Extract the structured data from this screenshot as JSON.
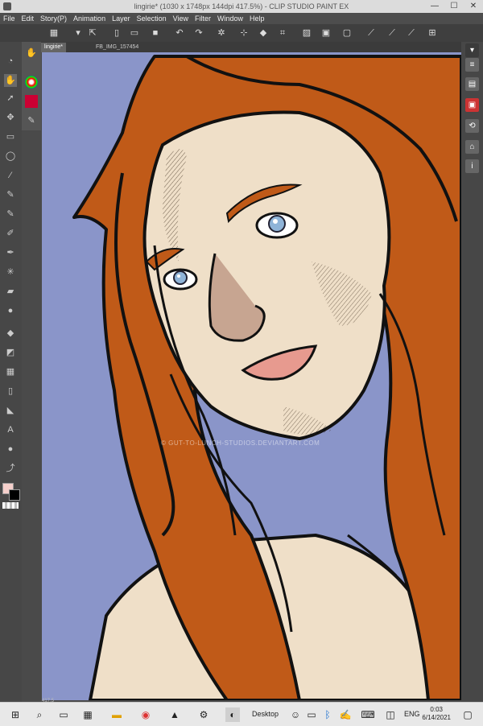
{
  "window": {
    "title": "lingirie* (1030 x 1748px 144dpi 417.5%) - CLIP STUDIO PAINT EX",
    "controls": [
      "—",
      "☐",
      "✕"
    ]
  },
  "menubar": {
    "items": [
      "File",
      "Edit",
      "Story(P)",
      "Animation",
      "Layer",
      "Selection",
      "View",
      "Filter",
      "Window",
      "Help"
    ]
  },
  "tabs": [
    {
      "label": "lingirie*"
    },
    {
      "label": "FB_IMG_157454"
    }
  ],
  "canvas": {
    "watermark": "© GUT-TO-LUNCH-STUDIOS.DEVIANTART.COM"
  },
  "status": {
    "zoom": "417.5"
  },
  "taskbar": {
    "desktop_label": "Desktop",
    "language": "ENG",
    "time": "0:03",
    "date": "6/14/2021"
  },
  "colors": {
    "background": "#8a95c9",
    "hair": "#c05a18",
    "skin": "#efdfc8",
    "eyes": "#8fb4d8",
    "lips": "#e79a8f",
    "ui_dark": "#474747",
    "taskbar": "#e8e8e8"
  }
}
